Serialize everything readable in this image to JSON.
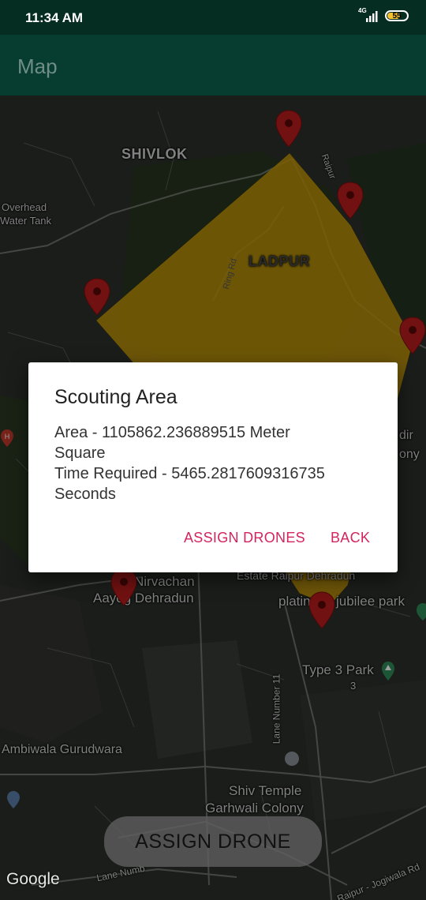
{
  "status_bar": {
    "time": "11:34 AM",
    "network": "4G",
    "battery": "55"
  },
  "app_bar": {
    "title": "Map"
  },
  "map": {
    "labels": {
      "shivlok": "SHIVLOK",
      "ladpur": "LADPUR",
      "ring_rd": "Ring Rd",
      "overhead_1": "Overhead",
      "overhead_2": "Water Tank",
      "raipur_road": "Raipur",
      "nirvachan_1": "Nirvachan",
      "nirvachan_2": "Aayog Dehradun",
      "estate": "Estate Raipur Dehradun",
      "jubilee_1": "plating",
      "jubilee_2": "jubilee park",
      "type3_1": "Type 3 Park",
      "type3_2": "3",
      "lane11": "Lane Number 11",
      "ambiwala": "Ambiwala Gurudwara",
      "shiv_temple": "Shiv Temple",
      "garhwali": "Garhwali Colony",
      "mandir_1": "dir",
      "mandir_2": "ony",
      "lane_bottom": "Lane Numb",
      "raipur_jogiwala": "Raipur - Jogiwala Rd"
    },
    "google": "Google",
    "polygon_color": "#c89a08",
    "marker_color": "#b71c1c"
  },
  "assign_button": {
    "label": "ASSIGN DRONE"
  },
  "dialog": {
    "title": "Scouting Area",
    "area_line_1": "Area - 1105862.236889515 Meter",
    "area_line_2": "Square",
    "time_line_1": "Time Required - 5465.2817609316735",
    "time_line_2": "Seconds",
    "assign_label": "ASSIGN DRONES",
    "back_label": "BACK"
  }
}
